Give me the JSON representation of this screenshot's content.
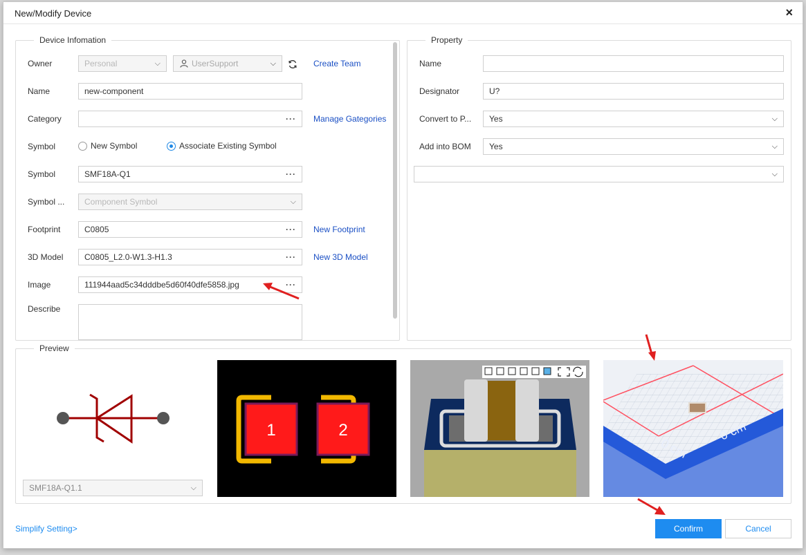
{
  "dialog": {
    "title": "New/Modify Device",
    "close_symbol": "×"
  },
  "device_info": {
    "legend": "Device Infomation",
    "owner": {
      "label": "Owner",
      "scope_value": "Personal",
      "user_value": "UserSupport",
      "create_team": "Create Team"
    },
    "name": {
      "label": "Name",
      "value": "new-component"
    },
    "category": {
      "label": "Category",
      "value": "",
      "manage": "Manage Gategories"
    },
    "symbol_mode": {
      "label": "Symbol",
      "option_new": "New Symbol",
      "option_existing": "Associate Existing Symbol",
      "selected": "Associate Existing Symbol"
    },
    "symbol": {
      "label": "Symbol",
      "value": "SMF18A-Q1"
    },
    "symbol_type": {
      "label": "Symbol ...",
      "value": "Component Symbol"
    },
    "footprint": {
      "label": "Footprint",
      "value": "C0805",
      "new": "New Footprint"
    },
    "model3d": {
      "label": "3D Model",
      "value": "C0805_L2.0-W1.3-H1.3",
      "new": "New 3D Model"
    },
    "image": {
      "label": "Image",
      "value": "111944aad5c34dddbe5d60f40dfe5858.jpg"
    },
    "describe": {
      "label": "Describe",
      "value": ""
    },
    "dots": "···"
  },
  "property": {
    "legend": "Property",
    "name": {
      "label": "Name",
      "value": ""
    },
    "designator": {
      "label": "Designator",
      "value": "U?"
    },
    "convert": {
      "label": "Convert to P...",
      "value": "Yes"
    },
    "bom": {
      "label": "Add into BOM",
      "value": "Yes"
    },
    "extra": {
      "value": ""
    }
  },
  "preview": {
    "legend": "Preview",
    "symbol_select": "SMF18A-Q1.1",
    "pad_1": "1",
    "pad_2": "2",
    "photo_text": "0 cm"
  },
  "footer": {
    "simplify": "Simplify Setting>",
    "confirm": "Confirm",
    "cancel": "Cancel"
  },
  "colors": {
    "accent": "#1e8cf0",
    "link": "#1a4fc4",
    "symbol_red": "#a00000",
    "pad_red": "#ff1a1a",
    "pad_outline": "#f2b800",
    "arrow_red": "#e02020"
  }
}
